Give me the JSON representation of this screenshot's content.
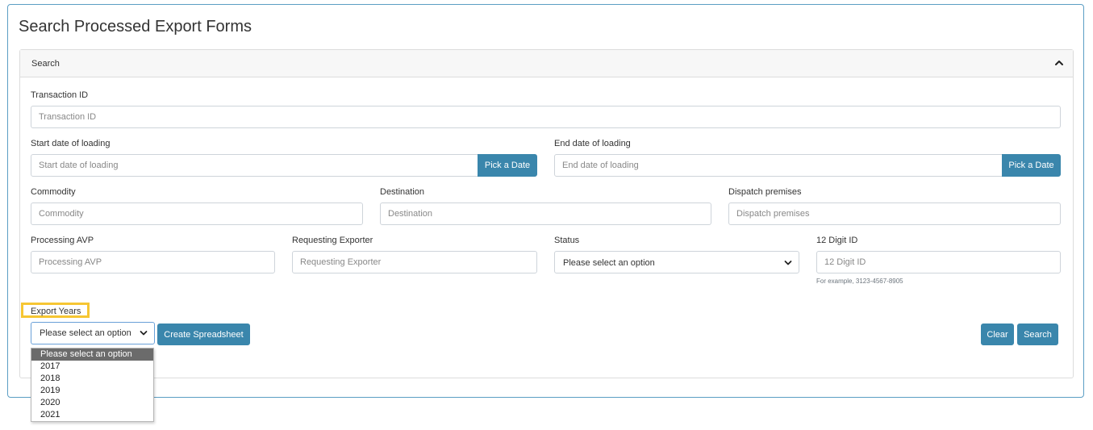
{
  "page": {
    "title": "Search Processed Export Forms"
  },
  "panel": {
    "header": "Search",
    "collapse_icon": "chevron-up-icon"
  },
  "fields": {
    "transaction_id": {
      "label": "Transaction ID",
      "placeholder": "Transaction ID"
    },
    "start_date": {
      "label": "Start date of loading",
      "placeholder": "Start date of loading",
      "button": "Pick a Date"
    },
    "end_date": {
      "label": "End date of loading",
      "placeholder": "End date of loading",
      "button": "Pick a Date"
    },
    "commodity": {
      "label": "Commodity",
      "placeholder": "Commodity"
    },
    "destination": {
      "label": "Destination",
      "placeholder": "Destination"
    },
    "dispatch_premises": {
      "label": "Dispatch premises",
      "placeholder": "Dispatch premises"
    },
    "processing_avp": {
      "label": "Processing AVP",
      "placeholder": "Processing AVP"
    },
    "requesting_exporter": {
      "label": "Requesting Exporter",
      "placeholder": "Requesting Exporter"
    },
    "status": {
      "label": "Status",
      "selected": "Please select an option"
    },
    "twelve_digit_id": {
      "label": "12 Digit ID",
      "placeholder": "12 Digit ID",
      "hint": "For example, 3123-4567-8905"
    }
  },
  "export_years": {
    "label": "Export Years",
    "selected": "Please select an option",
    "options": [
      "Please select an option",
      "2017",
      "2018",
      "2019",
      "2020",
      "2021"
    ]
  },
  "buttons": {
    "create_spreadsheet": "Create Spreadsheet",
    "clear": "Clear",
    "search": "Search"
  },
  "colors": {
    "primary": "#3a86ac",
    "highlight": "#f6c633",
    "border": "#5b9ec4"
  }
}
